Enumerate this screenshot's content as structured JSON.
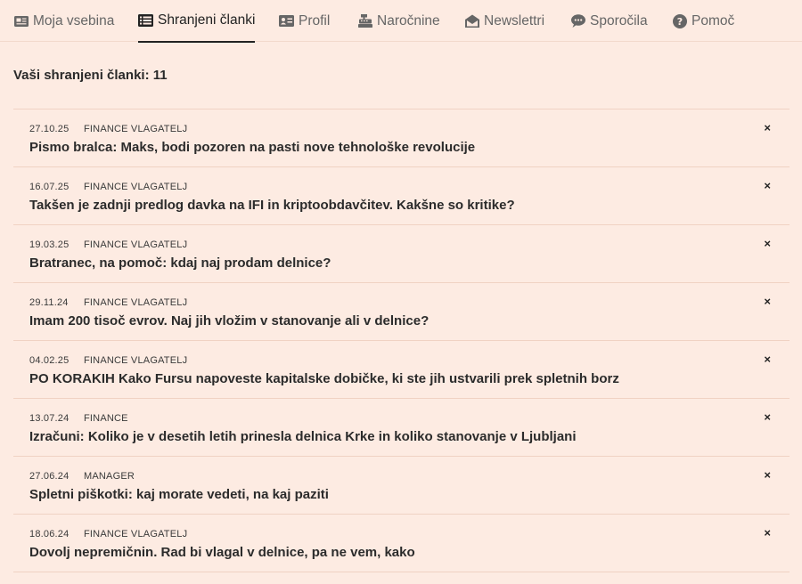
{
  "tabs": [
    {
      "label": "Moja vsebina",
      "icon": "newspaper-icon",
      "active": false
    },
    {
      "label": "Shranjeni članki",
      "icon": "list-icon",
      "active": true
    },
    {
      "label": "Profil",
      "icon": "id-card-icon",
      "active": false
    },
    {
      "label": "Naročnine",
      "icon": "cash-register-icon",
      "active": false
    },
    {
      "label": "Newslettri",
      "icon": "envelope-open-icon",
      "active": false
    },
    {
      "label": "Sporočila",
      "icon": "chat-bubble-icon",
      "active": false
    },
    {
      "label": "Pomoč",
      "icon": "question-circle-icon",
      "active": false
    }
  ],
  "saved": {
    "count_label": "Vaši shranjeni članki: 11",
    "remove_symbol": "×",
    "articles": [
      {
        "date": "27.10.25",
        "category": "FINANCE VLAGATELJ",
        "title": "Pismo bralca: Maks, bodi pozoren na pasti nove tehnološke revolucije"
      },
      {
        "date": "16.07.25",
        "category": "FINANCE VLAGATELJ",
        "title": "Takšen je zadnji predlog davka na IFI in kriptoobdavčitev. Kakšne so kritike?"
      },
      {
        "date": "19.03.25",
        "category": "FINANCE VLAGATELJ",
        "title": "Bratranec, na pomoč: kdaj naj prodam delnice?"
      },
      {
        "date": "29.11.24",
        "category": "FINANCE VLAGATELJ",
        "title": "Imam 200 tisoč evrov. Naj jih vložim v stanovanje ali v delnice?"
      },
      {
        "date": "04.02.25",
        "category": "FINANCE VLAGATELJ",
        "title": "PO KORAKIH Kako Fursu napoveste kapitalske dobičke, ki ste jih ustvarili prek spletnih borz"
      },
      {
        "date": "13.07.24",
        "category": "FINANCE",
        "title": "Izračuni: Koliko je v desetih letih prinesla delnica Krke in koliko stanovanje v Ljubljani"
      },
      {
        "date": "27.06.24",
        "category": "MANAGER",
        "title": "Spletni piškotki: kaj morate vedeti, na kaj paziti"
      },
      {
        "date": "18.06.24",
        "category": "FINANCE VLAGATELJ",
        "title": "Dovolj nepremičnin. Rad bi vlagal v delnice, pa ne vem, kako"
      }
    ]
  }
}
